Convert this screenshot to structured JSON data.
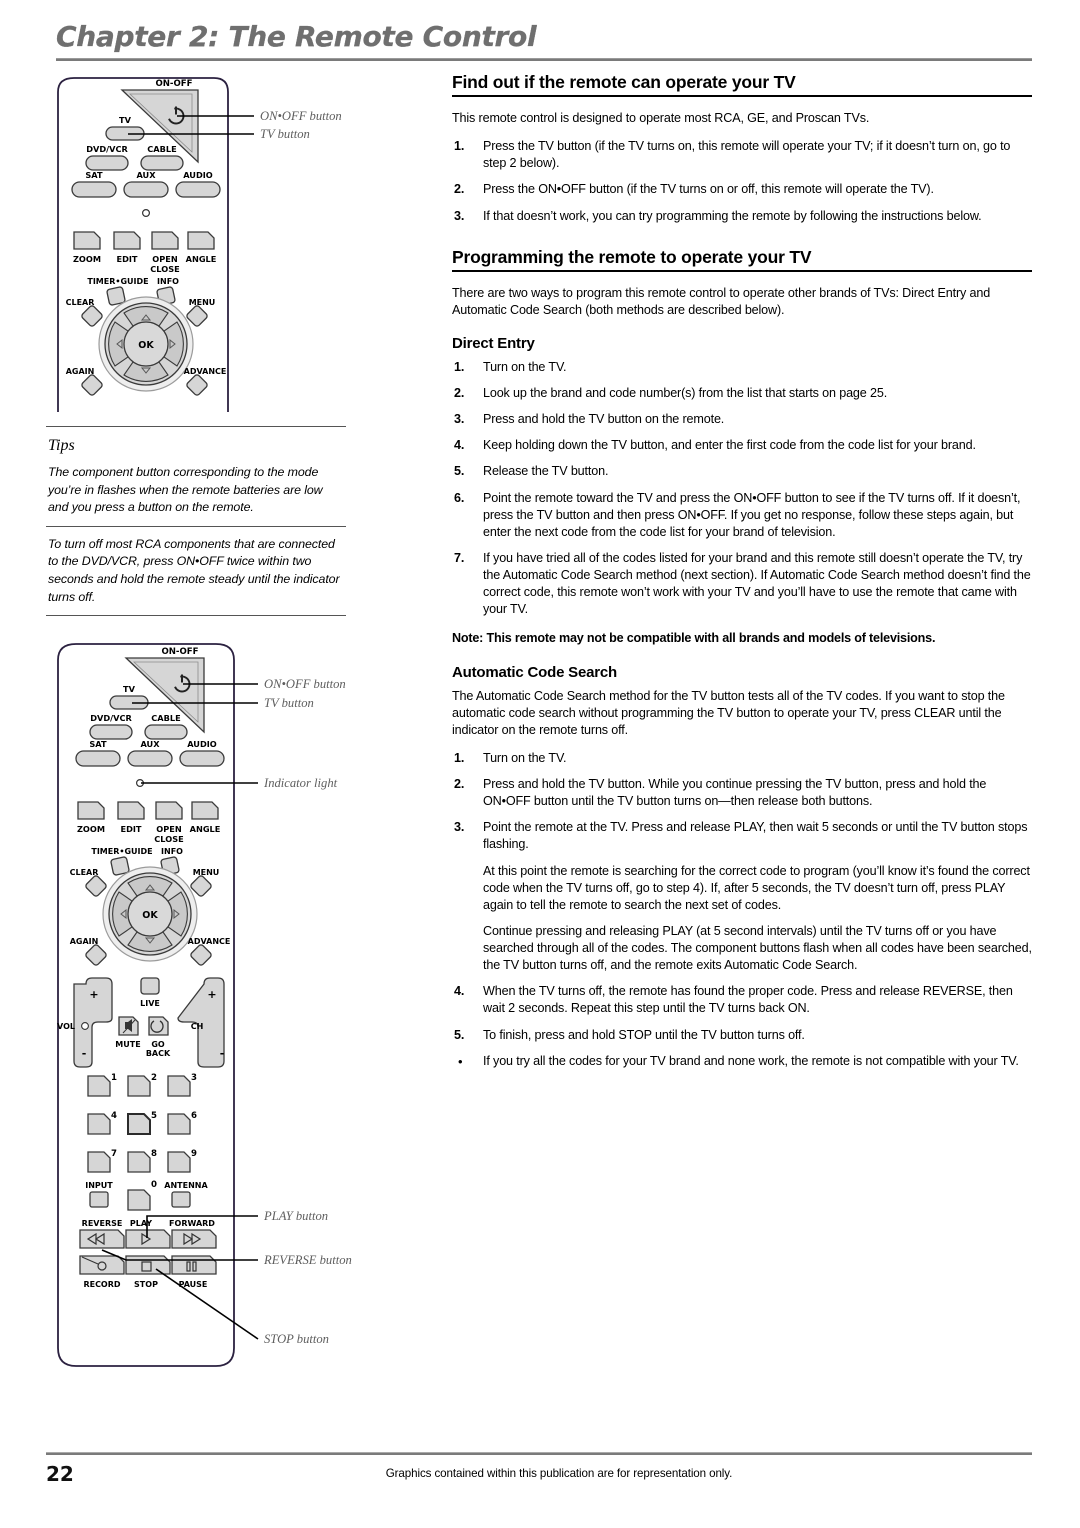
{
  "header": {
    "chapter_title": "Chapter 2: The Remote Control"
  },
  "main": {
    "section1": {
      "heading": "Find out if the remote can operate your TV",
      "intro": "This remote control is designed to operate most RCA, GE, and Proscan TVs.",
      "steps": [
        {
          "num": "1.",
          "text": "Press the TV button (if the TV turns on, this remote will operate your TV; if it doesn’t turn on, go to step 2 below)."
        },
        {
          "num": "2.",
          "text": "Press the ON•OFF button (if the TV turns on or off, this remote will operate the TV)."
        },
        {
          "num": "3.",
          "text": "If that doesn’t work, you can try programming the remote by following the instructions below."
        }
      ]
    },
    "section2": {
      "heading": "Programming the remote to operate your TV",
      "intro": "There are two ways to program this remote control to operate other brands of TVs: Direct Entry and Automatic Code Search (both methods are described below).",
      "direct_entry": {
        "heading": "Direct Entry",
        "steps": [
          {
            "num": "1.",
            "text": "Turn on the TV."
          },
          {
            "num": "2.",
            "text": "Look up the brand and code number(s) from the list that starts on page 25."
          },
          {
            "num": "3.",
            "text": "Press and hold the TV button on the remote."
          },
          {
            "num": "4.",
            "text": "Keep holding down the TV button, and enter the first code from the code list for your brand."
          },
          {
            "num": "5.",
            "text": "Release the TV button."
          },
          {
            "num": "6.",
            "text": "Point the remote toward the TV and press the ON•OFF button to see if the TV turns off. If it doesn’t, press the TV button and then press ON•OFF. If you get no response, follow these steps again, but enter the next code from the code list for your brand of television."
          },
          {
            "num": "7.",
            "text": "If you have tried all of the codes listed for your brand and this remote still doesn’t operate the TV, try the Automatic Code Search method (next section). If Automatic Code Search method doesn’t find the correct code, this remote won’t work with your TV and you’ll have to use the remote that came with your TV."
          }
        ],
        "page_ref": "25.",
        "note": "Note: This remote may not be compatible with all brands and models of televisions."
      },
      "auto_search": {
        "heading": "Automatic Code Search",
        "intro": "The Automatic Code Search method for the TV button tests all of the TV codes. If you want to stop the automatic code search without programming the TV button to operate your TV, press CLEAR until the indicator on the remote turns off.",
        "steps": [
          {
            "num": "1.",
            "text": "Turn on the TV."
          },
          {
            "num": "2.",
            "text": "Press and hold the TV button. While you continue pressing the TV button, press and hold the ON•OFF button until the TV button turns on—then release both buttons."
          },
          {
            "num": "3.",
            "text": "Point the remote at the TV. Press and release PLAY, then wait 5 seconds or until the TV button stops flashing."
          },
          {
            "num": "4.",
            "text": "When the TV turns off, the remote has found the proper code. Press and release REVERSE, then wait 2 seconds. Repeat this step until the TV turns back ON."
          },
          {
            "num": "5.",
            "text": "To finish, press and hold STOP until the TV button turns off."
          },
          {
            "num": "•",
            "text": "If you try all the codes for your TV brand and none work, the remote is not compatible with your TV."
          }
        ],
        "continuation_1": "At this point the remote is searching for the correct code to program (you’ll know it’s found the correct code when the TV turns off, go to step 4). If, after 5 seconds, the TV doesn’t turn off, press PLAY again to tell the remote to search the next set of codes.",
        "continuation_2": "Continue pressing and releasing PLAY (at 5 second intervals) until the TV turns off or you have searched through all of the codes. The component buttons flash when all codes have been searched, the TV button turns off, and the remote exits Automatic Code Search."
      }
    }
  },
  "tips": {
    "title": "Tips",
    "items": [
      "The component button corresponding to the mode you’re in flashes when the remote batteries are low and you press a button on the remote.",
      "To turn off most RCA components that are connected to the DVD/VCR, press ON•OFF twice within two seconds and hold the remote steady until the indicator turns off."
    ]
  },
  "remote_top": {
    "buttons": {
      "onoff": "ON-OFF",
      "tv": "TV",
      "dvdvcr": "DVD/VCR",
      "cable": "CABLE",
      "sat": "SAT",
      "aux": "AUX",
      "audio": "AUDIO",
      "zoom": "ZOOM",
      "edit": "EDIT",
      "open": "OPEN",
      "close": "CLOSE",
      "angle": "ANGLE",
      "timer_guide": "TIMER•GUIDE",
      "info": "INFO",
      "clear": "CLEAR",
      "menu": "MENU",
      "ok": "OK",
      "again": "AGAIN",
      "advance": "ADVANCE"
    },
    "callouts": [
      "ON•OFF button",
      "TV button"
    ]
  },
  "remote_full": {
    "buttons": {
      "onoff": "ON-OFF",
      "tv": "TV",
      "dvdvcr": "DVD/VCR",
      "cable": "CABLE",
      "sat": "SAT",
      "aux": "AUX",
      "audio": "AUDIO",
      "zoom": "ZOOM",
      "edit": "EDIT",
      "open": "OPEN",
      "close": "CLOSE",
      "angle": "ANGLE",
      "timer_guide": "TIMER•GUIDE",
      "info": "INFO",
      "clear": "CLEAR",
      "menu": "MENU",
      "ok": "OK",
      "again": "AGAIN",
      "advance": "ADVANCE",
      "live": "LIVE",
      "vol": "VOL",
      "ch": "CH",
      "mute": "MUTE",
      "go": "GO",
      "back": "BACK",
      "plus": "+",
      "minus": "-",
      "input": "INPUT",
      "antenna": "ANTENNA",
      "reverse": "REVERSE",
      "play": "PLAY",
      "forward": "FORWARD",
      "record": "RECORD",
      "stop": "STOP",
      "pause": "PAUSE",
      "num1": "1",
      "num2": "2",
      "num3": "3",
      "num4": "4",
      "num5": "5",
      "num6": "6",
      "num7": "7",
      "num8": "8",
      "num9": "9",
      "num0": "0"
    },
    "callouts": [
      "ON•OFF button",
      "TV button",
      "Indicator light",
      "PLAY button",
      "REVERSE button",
      "STOP button"
    ]
  },
  "footer": {
    "page_number": "22",
    "text": "Graphics contained within this publication are for representation only."
  },
  "colors": {
    "title_gray": "#6f6f6f",
    "rule_gray": "#7a7a7a",
    "callout_gray": "#5e5e5e",
    "button_fill": "#d6d6d6",
    "button_stroke": "#3a3a3a"
  }
}
